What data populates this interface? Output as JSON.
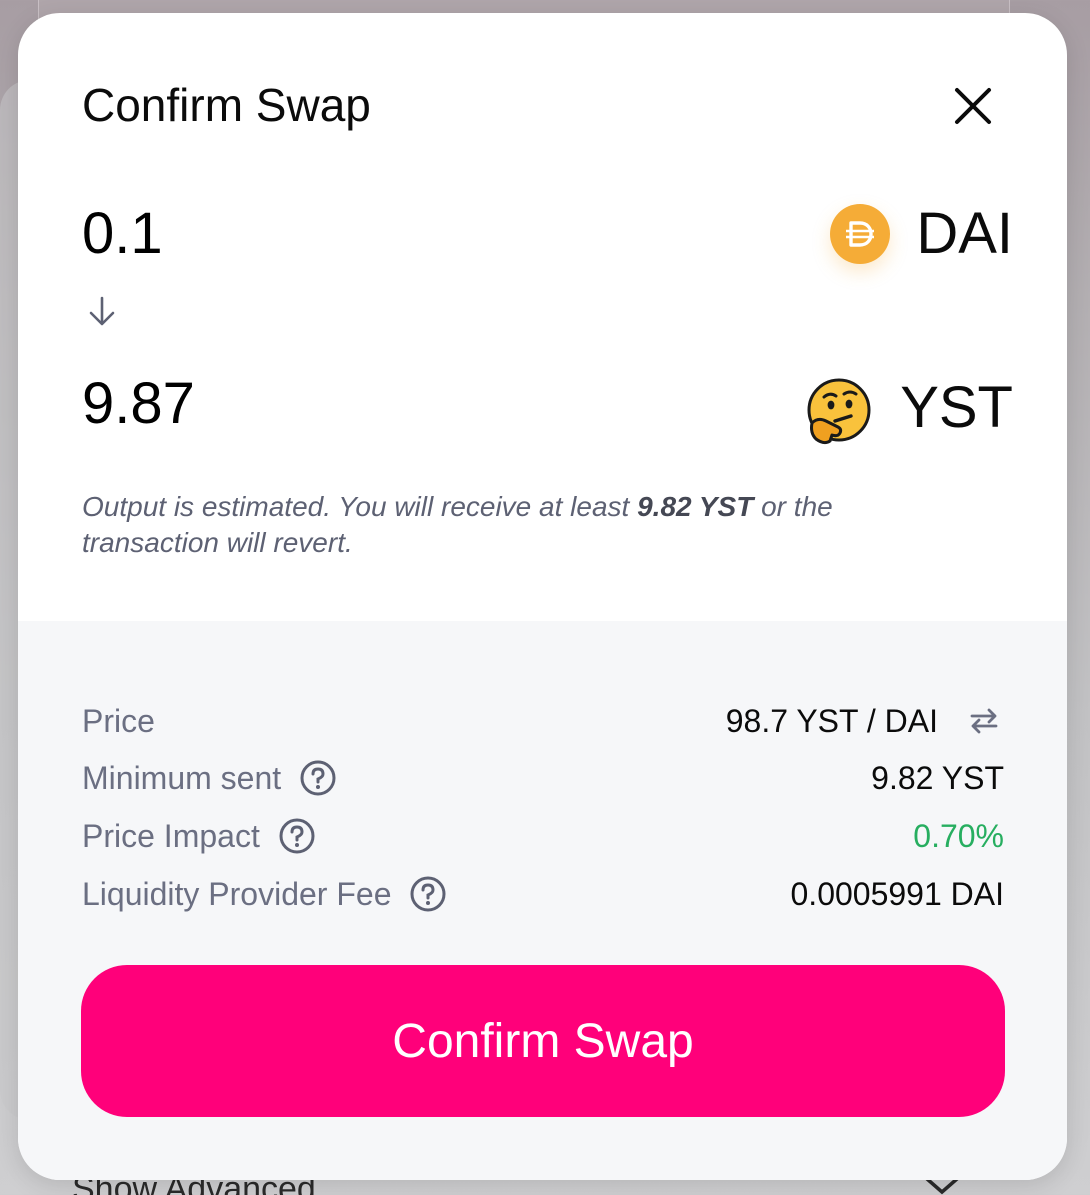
{
  "background": {
    "advanced_label": "Show Advanced"
  },
  "modal": {
    "title": "Confirm Swap",
    "input": {
      "amount": "0.1",
      "symbol": "DAI",
      "icon": "dai-token-icon"
    },
    "output": {
      "amount": "9.87",
      "symbol": "YST",
      "icon": "thinking-face-icon"
    },
    "note": {
      "prefix": "Output is estimated. You will receive at least ",
      "minimum": "9.82 YST",
      "suffix": " or the transaction will revert."
    },
    "details": {
      "price": {
        "label": "Price",
        "value": "98.7 YST / DAI"
      },
      "minimum_sent": {
        "label": "Minimum sent",
        "value": "9.82 YST"
      },
      "price_impact": {
        "label": "Price Impact",
        "value": "0.70%",
        "color": "#27ae60"
      },
      "lp_fee": {
        "label": "Liquidity Provider Fee",
        "value": "0.0005991 DAI"
      }
    },
    "confirm_label": "Confirm Swap"
  },
  "colors": {
    "accent": "#ff007a",
    "dai": "#f5ac37",
    "positive": "#27ae60"
  }
}
